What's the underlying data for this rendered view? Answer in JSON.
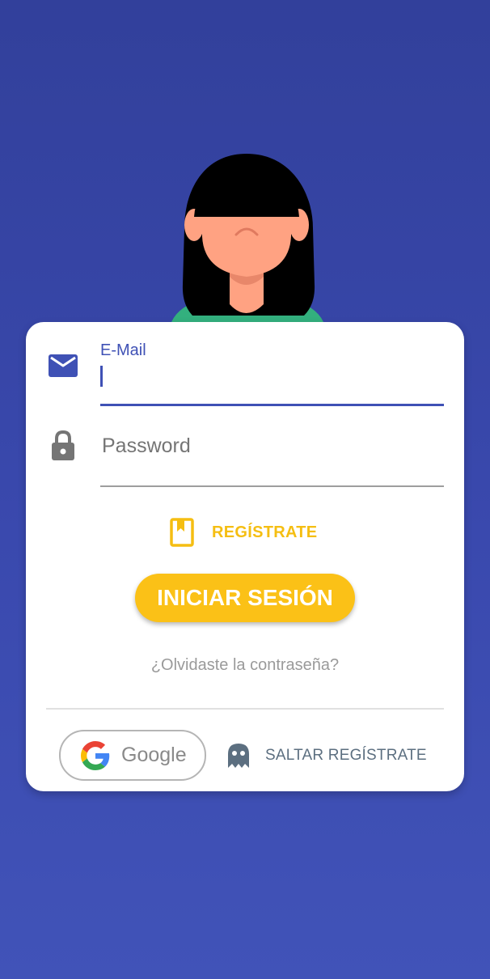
{
  "colors": {
    "background": "#3a49ae",
    "primary": "#3f51b5",
    "accent": "#fbc117",
    "skin": "#ffa282",
    "hair": "#000000",
    "shirt": "#33b07e"
  },
  "avatar": {
    "icon": "woman-avatar-illustration"
  },
  "login_form": {
    "email": {
      "label": "E-Mail",
      "value": "",
      "icon": "mail-icon"
    },
    "password": {
      "placeholder": "Password",
      "value": "",
      "icon": "lock-icon"
    },
    "register_label": "REGÍSTRATE",
    "register_icon": "bookmark-book-icon",
    "login_button_label": "INICIAR SESIÓN",
    "forgot_password_label": "¿Olvidaste la contraseña?",
    "google_button_label": "Google",
    "google_icon": "google-g-icon",
    "skip_label": "SALTAR REGÍSTRATE",
    "skip_icon": "ghost-icon"
  }
}
